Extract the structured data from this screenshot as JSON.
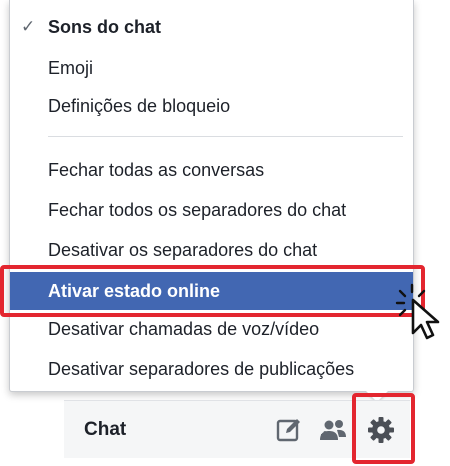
{
  "menu": {
    "items": [
      {
        "label": "Sons do chat",
        "checked": true
      },
      {
        "label": "Emoji"
      },
      {
        "label": "Definições de bloqueio"
      },
      {
        "label": "Fechar todas as conversas"
      },
      {
        "label": "Fechar todos os separadores do chat"
      },
      {
        "label": "Desativar os separadores do chat"
      },
      {
        "label": "Ativar estado online",
        "highlighted": true
      },
      {
        "label": "Desativar chamadas de voz/vídeo"
      },
      {
        "label": "Desativar separadores de publicações"
      }
    ],
    "check_glyph": "✓"
  },
  "chat_bar": {
    "title": "Chat",
    "icons": [
      "compose-icon",
      "add-people-icon",
      "gear-icon"
    ]
  },
  "colors": {
    "highlight": "#4267b2",
    "annotation_red": "#e3262f",
    "text": "#1d2129"
  }
}
